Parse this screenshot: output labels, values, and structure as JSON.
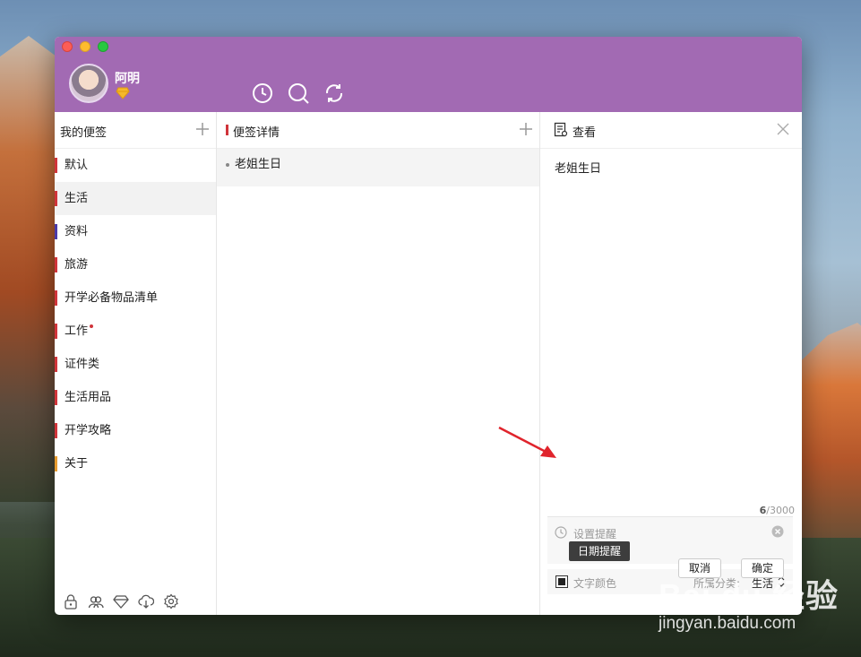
{
  "app": {
    "user": {
      "name": "阿明"
    },
    "toolbar_icons": [
      "clock-icon",
      "search-icon",
      "sync-icon"
    ]
  },
  "left": {
    "title": "我的便签",
    "categories": [
      {
        "label": "默认",
        "color": "#d0343a",
        "active": false,
        "dot": false
      },
      {
        "label": "生活",
        "color": "#d0343a",
        "active": true,
        "dot": false
      },
      {
        "label": "资料",
        "color": "#4a3aa8",
        "active": false,
        "dot": false
      },
      {
        "label": "旅游",
        "color": "#d0343a",
        "active": false,
        "dot": false
      },
      {
        "label": "开学必备物品清单",
        "color": "#d0343a",
        "active": false,
        "dot": false
      },
      {
        "label": "工作",
        "color": "#d0343a",
        "active": false,
        "dot": true
      },
      {
        "label": "证件类",
        "color": "#d0343a",
        "active": false,
        "dot": false
      },
      {
        "label": "生活用品",
        "color": "#d0343a",
        "active": false,
        "dot": false
      },
      {
        "label": "开学攻略",
        "color": "#d0343a",
        "active": false,
        "dot": false
      },
      {
        "label": "关于",
        "color": "#e69b2f",
        "active": false,
        "dot": false
      }
    ],
    "footer_icons": [
      "lock-icon",
      "group-icon",
      "diamond-icon",
      "cloud-download-icon",
      "settings-icon"
    ]
  },
  "middle": {
    "title": "便签详情",
    "notes": [
      {
        "text": "老姐生日"
      }
    ]
  },
  "right": {
    "title": "查看",
    "content": "老姐生日",
    "counter_current": "6",
    "counter_max": "/3000",
    "reminder_label": "设置提醒",
    "tooltip": "日期提醒",
    "color_label": "文字颜色",
    "category_label": "所属分类:",
    "category_value": "生活",
    "cancel_label": "取消",
    "ok_label": "确定"
  },
  "watermark": {
    "logo": "Bai du 经验",
    "url": "jingyan.baidu.com"
  },
  "colors": {
    "titlebar": "#a26ab3",
    "accent_red": "#d0343a"
  }
}
